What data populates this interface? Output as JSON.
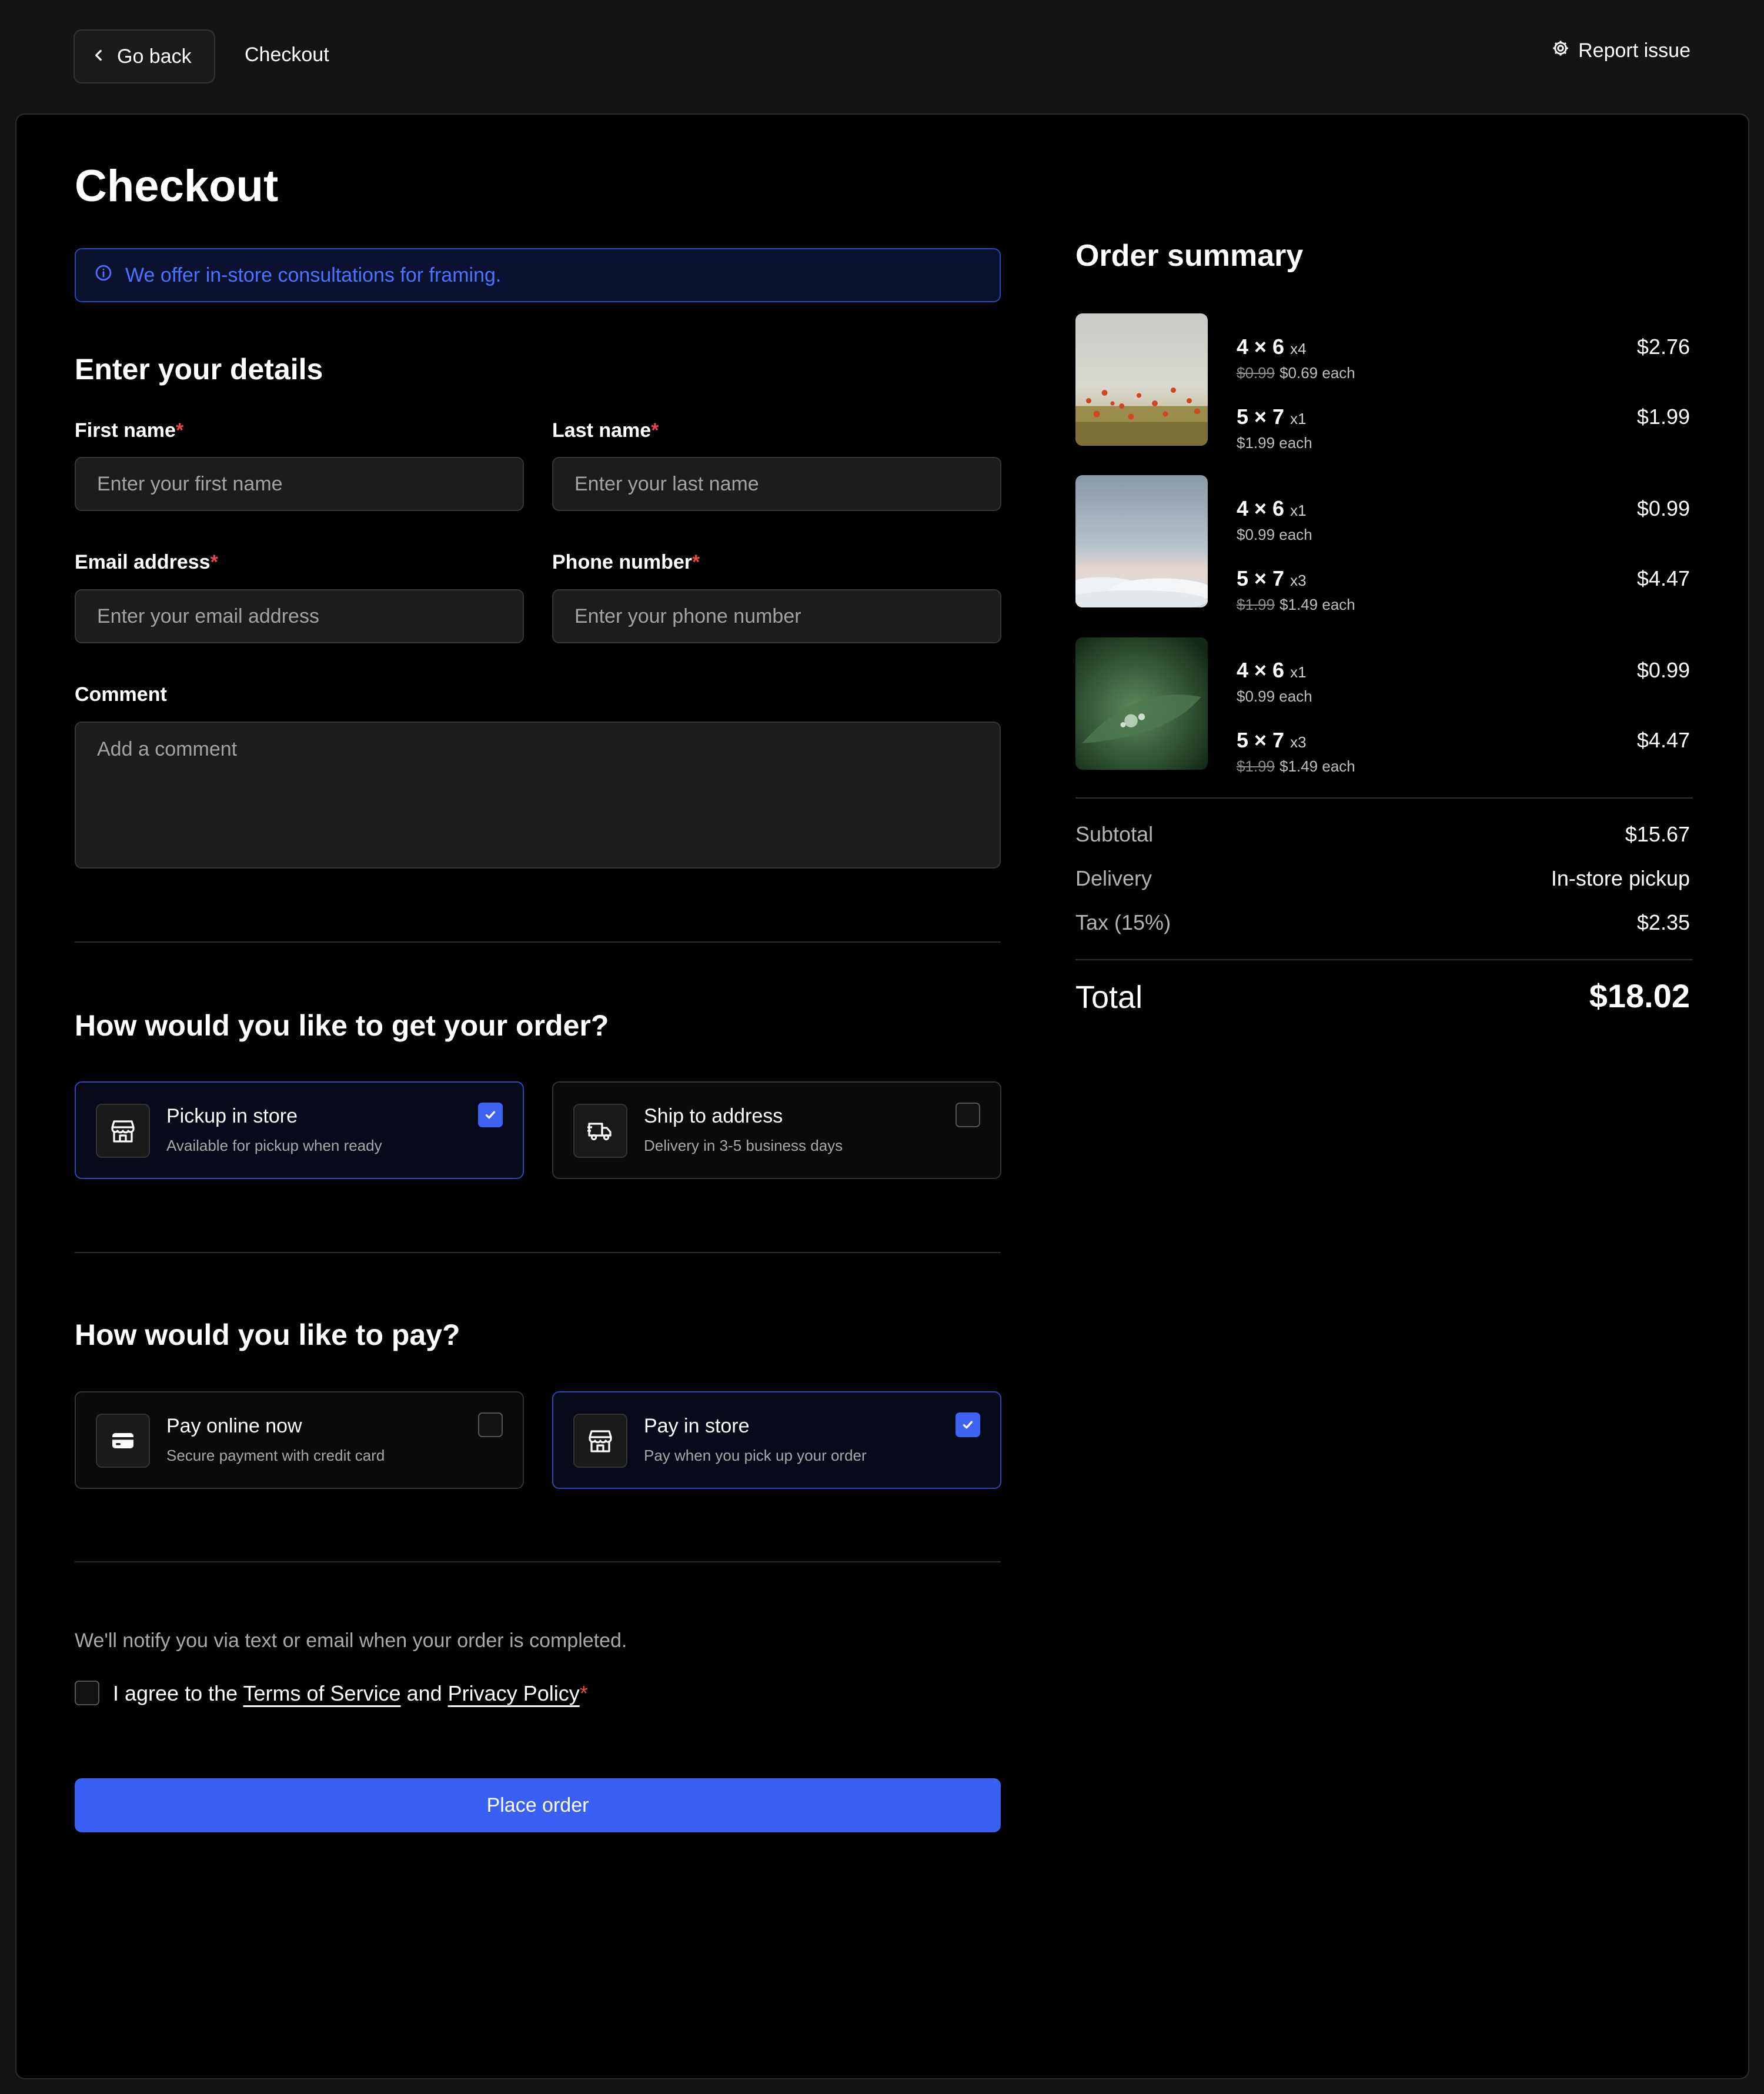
{
  "topbar": {
    "back_label": "Go back",
    "breadcrumb": "Checkout",
    "report_label": "Report issue"
  },
  "page": {
    "title": "Checkout",
    "info_banner": "We offer in-store consultations for framing."
  },
  "details": {
    "heading": "Enter your details",
    "first_name": {
      "label": "First name",
      "required_mark": "*",
      "placeholder": "Enter your first name",
      "value": ""
    },
    "last_name": {
      "label": "Last name",
      "required_mark": "*",
      "placeholder": "Enter your last name",
      "value": ""
    },
    "email": {
      "label": "Email address",
      "required_mark": "*",
      "placeholder": "Enter your email address",
      "value": ""
    },
    "phone": {
      "label": "Phone number",
      "required_mark": "*",
      "placeholder": "Enter your phone number",
      "value": ""
    },
    "comment": {
      "label": "Comment",
      "placeholder": "Add a comment",
      "value": ""
    }
  },
  "delivery": {
    "heading": "How would you like to get your order?",
    "options": [
      {
        "title": "Pickup in store",
        "subtitle": "Available for pickup when ready",
        "selected": true,
        "icon": "store-icon"
      },
      {
        "title": "Ship to address",
        "subtitle": "Delivery in 3-5 business days",
        "selected": false,
        "icon": "truck-icon"
      }
    ]
  },
  "payment": {
    "heading": "How would you like to pay?",
    "options": [
      {
        "title": "Pay online now",
        "subtitle": "Secure payment with credit card",
        "selected": false,
        "icon": "credit-card-icon"
      },
      {
        "title": "Pay in store",
        "subtitle": "Pay when you pick up your order",
        "selected": true,
        "icon": "store-icon"
      }
    ]
  },
  "footer": {
    "notify_text": "We'll notify you via text or email when your order is completed.",
    "agree_prefix": "I agree to the ",
    "terms_link": "Terms of Service",
    "agree_middle": " and ",
    "privacy_link": "Privacy Policy",
    "required_mark": "*",
    "agreed": false,
    "place_order_label": "Place order"
  },
  "summary": {
    "title": "Order summary",
    "products": [
      {
        "image": "poppy-field-photo",
        "lines": [
          {
            "size": "4 × 6",
            "qty": "x4",
            "old_price": "$0.99",
            "each": "$0.69 each",
            "price": "$2.76"
          },
          {
            "size": "5 × 7",
            "qty": "x1",
            "old_price": "",
            "each": "$1.99 each",
            "price": "$1.99"
          }
        ]
      },
      {
        "image": "clouds-photo",
        "lines": [
          {
            "size": "4 × 6",
            "qty": "x1",
            "old_price": "",
            "each": "$0.99 each",
            "price": "$0.99"
          },
          {
            "size": "5 × 7",
            "qty": "x3",
            "old_price": "$1.99",
            "each": "$1.49 each",
            "price": "$4.47"
          }
        ]
      },
      {
        "image": "leaf-dewdrop-photo",
        "lines": [
          {
            "size": "4 × 6",
            "qty": "x1",
            "old_price": "",
            "each": "$0.99 each",
            "price": "$0.99"
          },
          {
            "size": "5 × 7",
            "qty": "x3",
            "old_price": "$1.99",
            "each": "$1.49 each",
            "price": "$4.47"
          }
        ]
      }
    ],
    "subtotal_label": "Subtotal",
    "subtotal_value": "$15.67",
    "delivery_label": "Delivery",
    "delivery_value": "In-store pickup",
    "tax_label": "Tax (15%)",
    "tax_value": "$2.35",
    "total_label": "Total",
    "total_value": "$18.02"
  },
  "colors": {
    "accent": "#3a60f3",
    "required": "#e5484d",
    "panel_bg": "#000000",
    "page_bg": "#141414"
  }
}
